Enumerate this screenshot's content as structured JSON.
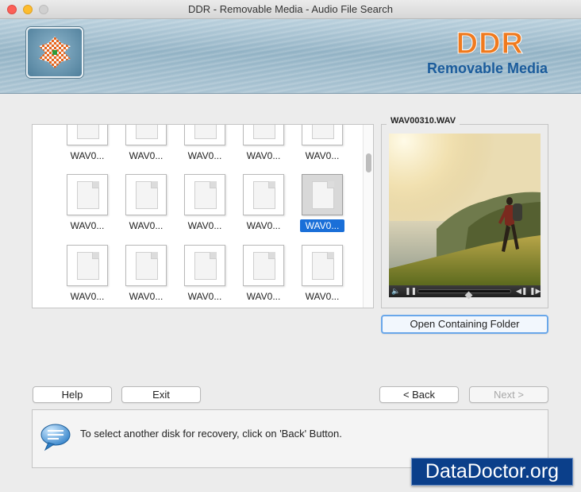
{
  "window": {
    "title": "DDR - Removable Media - Audio File Search"
  },
  "banner": {
    "brand": "DDR",
    "subtitle": "Removable Media"
  },
  "file_grid": {
    "rows": [
      [
        "WAV0...",
        "WAV0...",
        "WAV0...",
        "WAV0...",
        "WAV0..."
      ],
      [
        "WAV0...",
        "WAV0...",
        "WAV0...",
        "WAV0...",
        "WAV0..."
      ],
      [
        "WAV0...",
        "WAV0...",
        "WAV0...",
        "WAV0...",
        "WAV0..."
      ]
    ],
    "selected": {
      "row": 1,
      "col": 4
    }
  },
  "preview": {
    "filename": "WAV00310.WAV"
  },
  "buttons": {
    "open_folder": "Open Containing Folder",
    "help": "Help",
    "exit": "Exit",
    "back": "< Back",
    "next": "Next >"
  },
  "status": {
    "message": "To select another disk for recovery, click on 'Back' Button."
  },
  "watermark": "DataDoctor.org"
}
